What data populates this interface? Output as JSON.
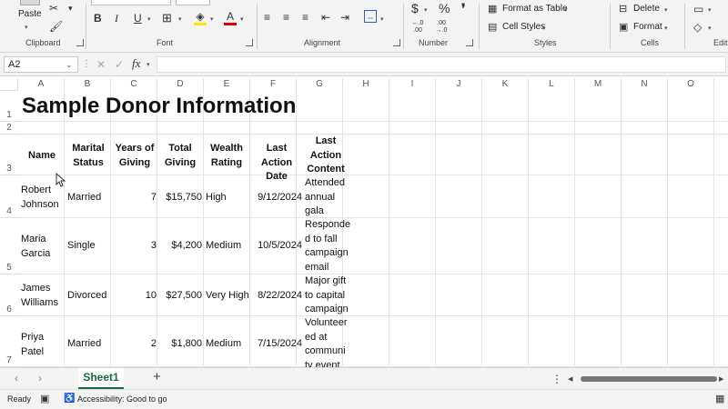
{
  "ribbon": {
    "paste_label": "Paste",
    "groups": {
      "clipboard": "Clipboard",
      "font": "Font",
      "alignment": "Alignment",
      "number": "Number",
      "styles": "Styles",
      "cells": "Cells",
      "editing": "Editi"
    },
    "styles_buttons": {
      "format_as_table": "Format as Table",
      "cell_styles": "Cell Styles"
    },
    "cells_buttons": {
      "delete": "Delete",
      "format": "Format"
    },
    "font_buttons": {
      "bold": "B",
      "italic": "I",
      "underline": "U"
    },
    "number_buttons": {
      "currency": "$",
      "percent": "%",
      "comma": "❜",
      "inc_decimal": "←.0 .00",
      "dec_decimal": ".00 →.0"
    }
  },
  "formula_bar": {
    "name_box": "A2",
    "fx": "fx",
    "content": ""
  },
  "columns": [
    "A",
    "B",
    "C",
    "D",
    "E",
    "F",
    "G",
    "H",
    "I",
    "J",
    "K",
    "L",
    "M",
    "N",
    "O"
  ],
  "rows": [
    "1",
    "2",
    "3",
    "4",
    "5",
    "6",
    "7"
  ],
  "sheet": {
    "title": "Sample Donor Information",
    "headers": {
      "name": "Name",
      "marital": [
        "Marital",
        "Status"
      ],
      "years": [
        "Years of",
        "Giving"
      ],
      "total": [
        "Total",
        "Giving"
      ],
      "wealth": [
        "Wealth",
        "Rating"
      ],
      "last_date": [
        "Last Action",
        "Date"
      ],
      "last_content": [
        "Last",
        "Action",
        "Content"
      ]
    },
    "donors": [
      {
        "name": [
          "Robert",
          "Johnson"
        ],
        "marital": "Married",
        "years": "7",
        "total": "$15,750",
        "wealth": "High",
        "date": "9/12/2024",
        "content": [
          "Attended",
          "annual",
          "gala"
        ]
      },
      {
        "name": [
          "Maria",
          "Garcia"
        ],
        "marital": "Single",
        "years": "3",
        "total": "$4,200",
        "wealth": "Medium",
        "date": "10/5/2024",
        "content": [
          "Responde",
          "d to fall",
          "campaign",
          "email"
        ]
      },
      {
        "name": [
          "James",
          "Williams"
        ],
        "marital": "Divorced",
        "years": "10",
        "total": "$27,500",
        "wealth": "Very High",
        "date": "8/22/2024",
        "content": [
          "Major gift",
          "to capital",
          "campaign"
        ]
      },
      {
        "name": [
          "Priya",
          "Patel"
        ],
        "marital": "Married",
        "years": "2",
        "total": "$1,800",
        "wealth": "Medium",
        "date": "7/15/2024",
        "content": [
          "Volunteer",
          "ed at",
          "communi",
          "ty event"
        ]
      }
    ]
  },
  "tabs": {
    "active": "Sheet1",
    "add": "+"
  },
  "status": {
    "ready": "Ready",
    "accessibility": "Accessibility: Good to go"
  }
}
